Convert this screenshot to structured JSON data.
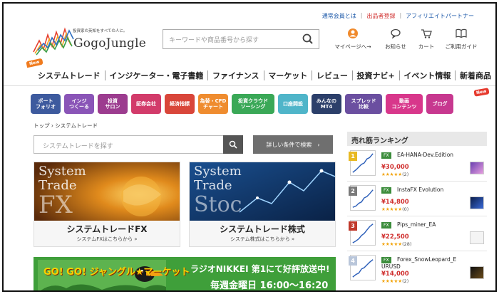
{
  "toplinks": {
    "member": "通常会員とは",
    "register": "出品者登録",
    "affiliate": "アフィリエイトパートナー"
  },
  "logo": {
    "tagline": "投資家の英知をすべての人に。",
    "name": "GogoJungle"
  },
  "search": {
    "placeholder": "キーワードや商品番号から探す"
  },
  "header_icons": [
    {
      "label": "マイページへ→",
      "icon": "user-icon"
    },
    {
      "label": "お知らせ",
      "icon": "speech-bubble-icon"
    },
    {
      "label": "カート",
      "icon": "cart-icon"
    },
    {
      "label": "ご利用ガイド",
      "icon": "book-icon"
    }
  ],
  "nav": {
    "badge": "New",
    "items": [
      "システムトレード",
      "インジケーター・電子書籍",
      "ファイナンス",
      "マーケット",
      "レビュー",
      "投資ナビ+",
      "イベント情報",
      "新着商品"
    ]
  },
  "categories": [
    {
      "label": "ポート\nフォリオ",
      "color": "#3d5a9e"
    },
    {
      "label": "インジ\nつくーる",
      "color": "#8a55b7"
    },
    {
      "label": "投資\nサロン",
      "color": "#9c3c8f"
    },
    {
      "label": "証券会社",
      "color": "#d23b6a"
    },
    {
      "label": "経済指標",
      "color": "#d9463a"
    },
    {
      "label": "為替・CFD\nチャート",
      "color": "#ef8c2f"
    },
    {
      "label": "投資クラウド\nソーシング",
      "color": "#3aa857"
    },
    {
      "label": "口座開設",
      "color": "#4fb5c9"
    },
    {
      "label": "みんなの\nMT4",
      "color": "#2c3f6a"
    },
    {
      "label": "スプレッド\n比較",
      "color": "#6b4fa0"
    },
    {
      "label": "動画\nコンテンツ",
      "color": "#d8378b"
    },
    {
      "label": "ブログ",
      "color": "#c7388f"
    }
  ],
  "blog_badge": "New",
  "breadcrumb": "トップ › システムトレード",
  "main_search": {
    "placeholder": "システムトレードを探す",
    "advanced": "詳しい条件で検索　›"
  },
  "banners": [
    {
      "overlay1": "System",
      "overlay2": "Trade",
      "overlay3": "FX",
      "title": "システムトレードFX",
      "sub": "システムFXはこちらから »"
    },
    {
      "overlay1": "System",
      "overlay2": "Trade",
      "overlay3": "Stoc",
      "title": "システムトレード株式",
      "sub": "システム株式はこちらから »"
    }
  ],
  "radio": {
    "logo_text": "GO! GO! ジャングル★マーケット",
    "line1": "ラジオNIKKEI 第1にて好評放送中!",
    "line2": "毎週金曜日 16:00～16:20"
  },
  "ranking": {
    "title": "売れ筋ランキング",
    "items": [
      {
        "rank": "1",
        "rank_color": "#e8b923",
        "tag": "FX",
        "name": "EA-HANA-Dev.Edition",
        "price": "¥30,000",
        "stars": "★★★★★",
        "count": "(2)"
      },
      {
        "rank": "2",
        "rank_color": "#7a7a7a",
        "tag": "FX",
        "name": "InstaFX Evolution",
        "price": "¥14,800",
        "stars": "★★★★★",
        "count": "(0)"
      },
      {
        "rank": "3",
        "rank_color": "#c0392b",
        "tag": "FX",
        "name": "Pips_miner_EA",
        "price": "¥22,500",
        "stars": "★★★★★",
        "count": "(28)"
      },
      {
        "rank": "4",
        "rank_color": "#b9c6da",
        "tag": "FX",
        "name": "Forex_SnowLeopard_E",
        "name2": "URUSD",
        "price": "¥14,000",
        "stars": "★★★★★",
        "count": "(2)"
      }
    ]
  }
}
